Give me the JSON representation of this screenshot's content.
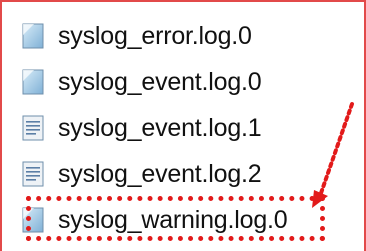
{
  "files": [
    {
      "name": "syslog_error.log.0",
      "icon": "text-file-icon"
    },
    {
      "name": "syslog_event.log.0",
      "icon": "text-file-icon"
    },
    {
      "name": "syslog_event.log.1",
      "icon": "text-file-icon"
    },
    {
      "name": "syslog_event.log.2",
      "icon": "text-file-icon"
    },
    {
      "name": "syslog_warning.log.0",
      "icon": "text-file-icon"
    }
  ],
  "highlighted_file": "syslog_warning.log.0",
  "colors": {
    "highlight": "#e21a1a",
    "frame_border": "#e24a4a"
  }
}
